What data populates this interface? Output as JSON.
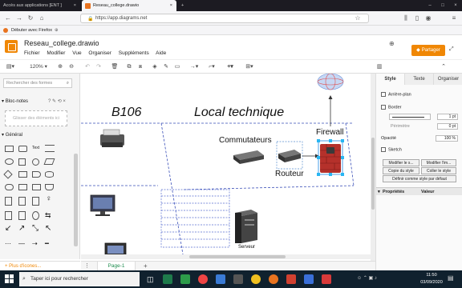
{
  "browser": {
    "tabs": [
      {
        "label": "Accès aux applications [ENT ]",
        "active": false
      },
      {
        "label": "Reseau_college.drawio",
        "active": true
      }
    ],
    "new_tab": "+",
    "url": "https://app.diagrams.net",
    "bookmark": "Débuter avec Firefox",
    "window_controls": [
      "–",
      "□",
      "×"
    ]
  },
  "app": {
    "title": "Reseau_college.drawio",
    "menu": [
      "Fichier",
      "Modifier",
      "Vue",
      "Organiser",
      "Suppléments",
      "Aide"
    ],
    "share_label": "Partager",
    "accent": "#f08705"
  },
  "toolbar": {
    "zoom": "120%",
    "items": [
      "page-view-icon",
      "zoom-in-icon",
      "zoom-out-icon",
      "undo-icon",
      "redo-icon",
      "delete-icon",
      "to-front-icon",
      "to-back-icon",
      "fill-color-icon",
      "line-color-icon",
      "shadow-icon",
      "connection-icon",
      "waypoints-icon",
      "insert-icon",
      "table-icon"
    ]
  },
  "sidebar": {
    "search_placeholder": "Rechercher des formes",
    "notepad_title": "Bloc-notes",
    "notepad_icons": "? ✎ ⟲ ×",
    "notepad_drop_hint": "Glisser des éléments ici",
    "general_title": "Général",
    "text_shape": "Text",
    "more_shapes": "+ Plus d'icones..."
  },
  "diagram": {
    "labels": {
      "room": "B106",
      "location": "Local  technique",
      "switches": "Commutateurs",
      "router": "Routeur",
      "firewall": "Firewall",
      "server": "Serveur"
    }
  },
  "format_panel": {
    "tabs": [
      "Style",
      "Texte",
      "Organiser"
    ],
    "background_label": "Arrière-plan",
    "border_label": "Border",
    "border_width": "1 pt",
    "perimeter_label": "Périmètre",
    "perimeter_value": "0 pt",
    "opacity_label": "Opacité",
    "opacity_value": "100 %",
    "sketch_label": "Sketch",
    "buttons": [
      "Modifier le s...",
      "Modifier l'im...",
      "Copie du style",
      "Coller le style",
      "Définir comme style par défaut"
    ],
    "properties_header": "Propriétés",
    "value_header": "Valeur"
  },
  "pages": {
    "current": "Page-1"
  },
  "taskbar": {
    "search_placeholder": "Taper ici pour rechercher",
    "time": "11:50",
    "date": "03/09/2020"
  }
}
